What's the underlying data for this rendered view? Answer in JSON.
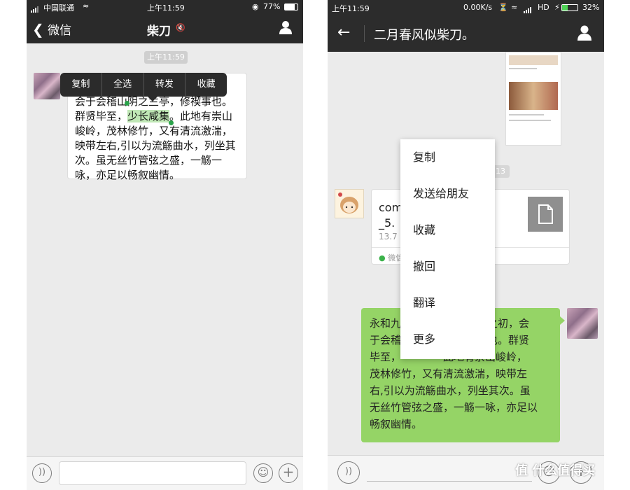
{
  "left": {
    "status": {
      "carrier": "中国联通",
      "time": "上午11:59",
      "battery": "77%"
    },
    "nav": {
      "back_label": "微信",
      "title": "柴刀"
    },
    "time_pill": "上午11:59",
    "message": {
      "line1_rest": "会于会稽山",
      "line1_b": "阴之兰亭，修禊事也。",
      "line2_pre": "群贤毕至，",
      "line2_sel": "少长咸集",
      "line2_post": "。此地有崇山",
      "line3": "峻岭，茂林修竹，又有清流激湍，",
      "line4": "映带左右,引以为流觞曲水，列坐其",
      "line5": "次。虽无丝竹管弦之盛，一觞一",
      "line6": "咏，亦足以畅叙幽情。"
    },
    "popup": [
      "复制",
      "全选",
      "转发",
      "收藏"
    ]
  },
  "right": {
    "status": {
      "time": "上午11:59",
      "speed": "0.00K/s",
      "network": "HD",
      "battery": "32%"
    },
    "nav": {
      "title": "二月春风似柴刀。"
    },
    "time_pill_partial": "13",
    "file_card": {
      "name_partial": "com",
      "name_partial2": "_5.",
      "size_partial": "13.7",
      "source_partial": "微信"
    },
    "message": {
      "line1_a": "永和九",
      "line1_b": "春之初，会",
      "line2_a": "于会稽",
      "line2_b": "事也。群贤",
      "line3_a": "毕至，",
      "line3_b": "此地有崇山峻岭，",
      "line4": "茂林修竹，又有清流激湍，映带左",
      "line5": "右,引以为流觞曲水，列坐其次。虽",
      "line6": "无丝竹管弦之盛，一觞一咏，亦足以",
      "line7": "畅叙幽情。"
    },
    "menu": [
      "复制",
      "发送给朋友",
      "收藏",
      "撤回",
      "翻译",
      "更多"
    ]
  },
  "watermark": "值 什么值得买"
}
